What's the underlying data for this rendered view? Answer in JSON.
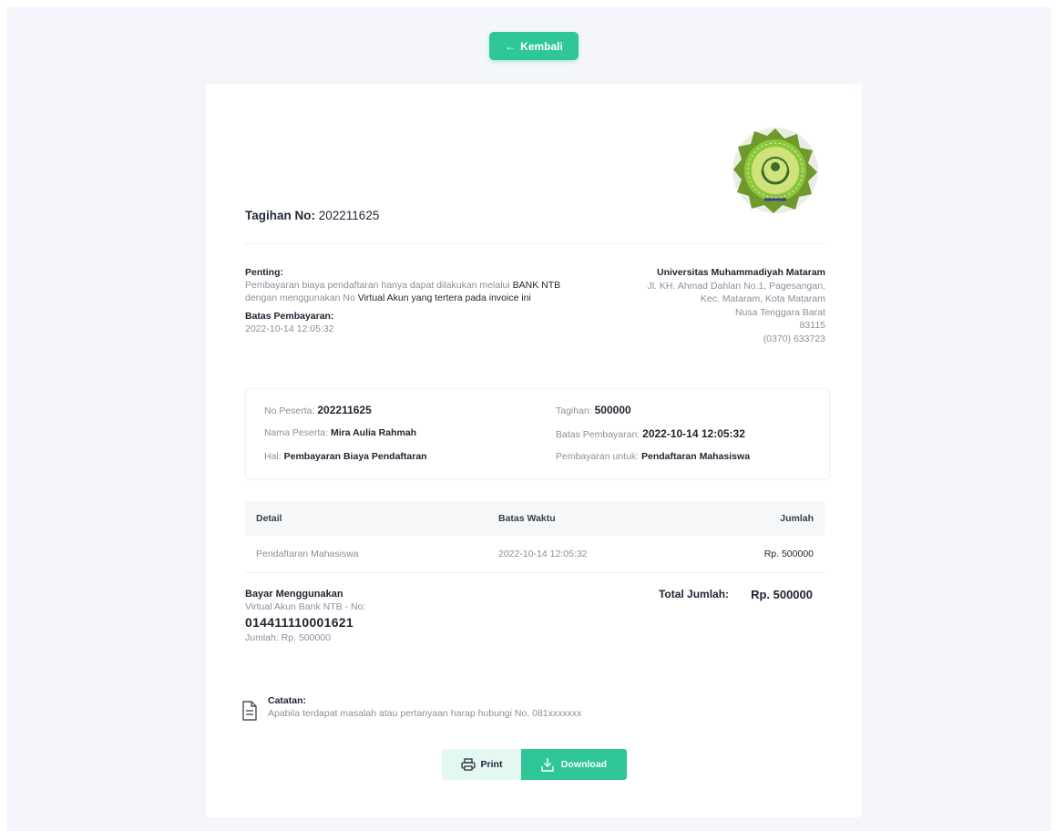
{
  "colors": {
    "accent": "#2fc79a",
    "background": "#f4f6fb",
    "muted": "#8a909b"
  },
  "header": {
    "back_label": "Kembali"
  },
  "invoice": {
    "title_label": "Tagihan No:",
    "number": "202211625",
    "logo_icon": "university-seal-logo"
  },
  "notice": {
    "label": "Penting:",
    "text_1": "Pembayaran biaya pendaftaran hanya dapat dilakukan melalui",
    "text_2": "BANK NTB",
    "text_3": " dengan menggunakan No ",
    "text_4": "Virtual Akun yang tertera pada invoice ini",
    "deadline_label": "Batas Pembayaran:",
    "deadline_value": "2022-10-14 12:05:32"
  },
  "address": {
    "org": "Universitas Muhammadiyah Mataram",
    "lines": [
      "Jl. KH. Ahmad Dahlan No.1, Pagesangan,",
      "Kec. Mataram, Kota Mataram",
      "Nusa Tenggara Barat",
      "83115",
      "(0370) 633723"
    ]
  },
  "info": {
    "participant_no_label": "No Peserta:",
    "participant_no": "202211625",
    "participant_name_label": "Nama Peserta:",
    "participant_name": "Mira Aulia Rahmah",
    "subject_label": "Hal:",
    "subject": "Pembayaran Biaya Pendaftaran",
    "bill_label": "Tagihan:",
    "bill": "500000",
    "deadline_label": "Batas Pembayaran:",
    "deadline": "2022-10-14 12:05:32",
    "purpose_label": "Pembayaran untuk:",
    "purpose": "Pendaftaran Mahasiswa"
  },
  "table": {
    "headers": [
      "Detail",
      "Batas Waktu",
      "Jumlah"
    ],
    "rows": [
      [
        "Pendaftaran Mahasiswa",
        "2022-10-14 12:05:32",
        "Rp. 500000"
      ]
    ]
  },
  "payment": {
    "label": "Bayar Menggunakan",
    "va_label": "Virtual Akun Bank NTB - No:",
    "va_number": "014411110001621",
    "amount_label": "Jumlah: Rp. 500000",
    "total_label": "Total Jumlah:",
    "total_value": "Rp. 500000"
  },
  "note": {
    "label": "Catatan:",
    "text": "Apabila terdapat masalah atau pertanyaan harap hubungi No. 081xxxxxxx",
    "icon": "document-icon"
  },
  "actions": {
    "print_label": "Print",
    "download_label": "Download"
  }
}
